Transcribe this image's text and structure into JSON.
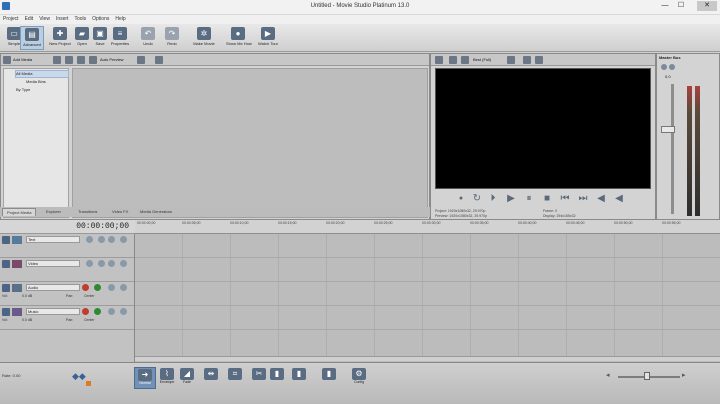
{
  "window": {
    "title": "Untitled - Movie Studio Platinum 13.0",
    "minimize": "—",
    "maximize": "☐",
    "close": "✕"
  },
  "menu": [
    "Project",
    "Edit",
    "View",
    "Insert",
    "Tools",
    "Options",
    "Help"
  ],
  "toolbar": {
    "buttons": [
      {
        "label": "Simple",
        "icon": "simple-mode-icon",
        "glyph": "▭"
      },
      {
        "label": "Advanced",
        "icon": "advanced-mode-icon",
        "glyph": "▤"
      },
      {
        "label": "New Project",
        "icon": "new-project-icon",
        "glyph": "✚"
      },
      {
        "label": "Open",
        "icon": "open-folder-icon",
        "glyph": "▰"
      },
      {
        "label": "Save",
        "icon": "save-icon",
        "glyph": "▣"
      },
      {
        "label": "Properties",
        "icon": "properties-icon",
        "glyph": "≡"
      },
      {
        "label": "Undo",
        "icon": "undo-icon",
        "glyph": "↶"
      },
      {
        "label": "Redo",
        "icon": "redo-icon",
        "glyph": "↷"
      },
      {
        "label": "Make Movie",
        "icon": "make-movie-icon",
        "glyph": "✲"
      },
      {
        "label": "Show Me How",
        "icon": "show-me-how-icon",
        "glyph": "●"
      },
      {
        "label": "Watch Tour",
        "icon": "watch-tour-icon",
        "glyph": "▶"
      }
    ]
  },
  "media": {
    "toolbar": {
      "add_media": "Add Media",
      "auto_preview": "Auto Preview"
    },
    "tree": [
      "All Media",
      "Media Bins",
      "By Type"
    ],
    "tabs": [
      "Project Media",
      "Explorer",
      "Transitions",
      "Video FX",
      "Media Generators"
    ]
  },
  "preview": {
    "toolbar": {
      "quality": "Best (Full)"
    },
    "info": {
      "project_label": "Project:",
      "project_value": "1920x1080x32, 29.970p",
      "preview_label": "Preview:",
      "preview_value": "1920x1080x32, 29.970p",
      "frame_label": "Frame:",
      "frame_value": "0",
      "display_label": "Display:",
      "display_value": "294x165x32"
    }
  },
  "master_bus": {
    "title": "Master Bus",
    "fader_value": "0.0"
  },
  "timeline": {
    "timecode": "00:00:00;00",
    "ruler": [
      "00:00:00;00",
      "00:00:05;00",
      "00:00:10;00",
      "00:00:15;00",
      "00:00:20;00",
      "00:00:25;00",
      "00:00:30;00",
      "00:00:35;00",
      "00:00:40;00",
      "00:00:45;00",
      "00:00:50;00",
      "00:00:55;00"
    ],
    "tracks": [
      {
        "num": "1",
        "name": "Text",
        "type": "video"
      },
      {
        "num": "2",
        "name": "Video",
        "type": "video"
      },
      {
        "num": "3",
        "name": "Audio",
        "type": "audio",
        "vol": "Vol:",
        "vol_val": "0.0 dB",
        "pan": "Pan:",
        "pan_val": "Center"
      },
      {
        "num": "4",
        "name": "Music",
        "type": "audio",
        "vol": "Vol:",
        "vol_val": "0.0 dB",
        "pan": "Pan:",
        "pan_val": "Center"
      }
    ]
  },
  "bottom": {
    "status": "Rate: 0.00",
    "tools": [
      {
        "label": "Normal",
        "icon": "normal-edit-icon",
        "glyph": "➜"
      },
      {
        "label": "Envelope",
        "icon": "envelope-tool-icon",
        "glyph": "⌇"
      },
      {
        "label": "Fade",
        "icon": "fade-tool-icon",
        "glyph": "◢"
      },
      {
        "label": "",
        "icon": "split-icon",
        "glyph": "⇹"
      },
      {
        "label": "",
        "icon": "crop-icon",
        "glyph": "⌗"
      },
      {
        "label": "",
        "icon": "trim-icon",
        "glyph": "✂"
      },
      {
        "label": "",
        "icon": "cut-icon",
        "glyph": "▮"
      },
      {
        "label": "",
        "icon": "copy-icon",
        "glyph": "▮"
      },
      {
        "label": "",
        "icon": "paste-icon",
        "glyph": "▮"
      },
      {
        "label": "Config",
        "icon": "config-icon",
        "glyph": "⚙"
      }
    ]
  }
}
